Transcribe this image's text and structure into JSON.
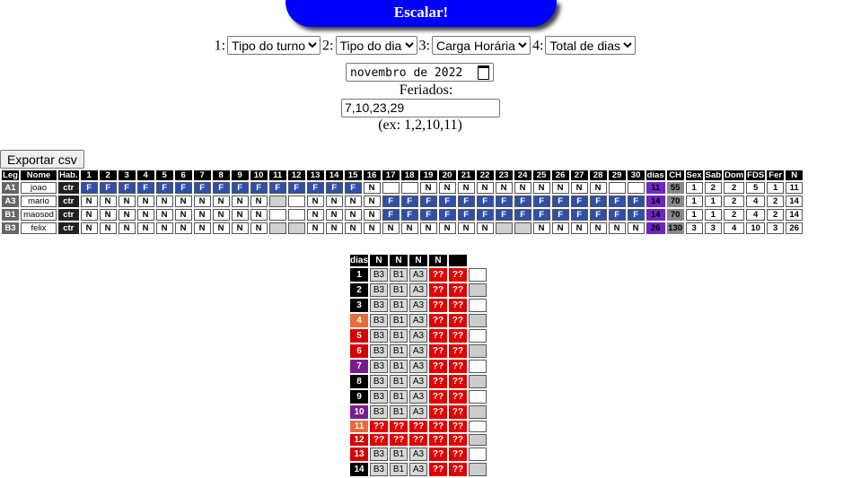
{
  "escalar_label": "Escalar!",
  "criteria": [
    {
      "num": "1:",
      "value": "Tipo do turno"
    },
    {
      "num": "2:",
      "value": "Tipo do dia"
    },
    {
      "num": "3:",
      "value": "Carga Horária"
    },
    {
      "num": "4:",
      "value": "Total de dias"
    }
  ],
  "month_value": "novembro de 2022",
  "feriados_label": "Feriados:",
  "feriados_value": "7,10,23,29",
  "feriados_hint": "(ex: 1,2,10,11)",
  "export_label": "Exportar csv",
  "schedule": {
    "headers": [
      "Leg",
      "Nome",
      "Hab."
    ],
    "day_colors": [
      "black",
      "black",
      "black",
      "orange",
      "red",
      "red",
      "purple",
      "black",
      "black",
      "purple",
      "orange",
      "red",
      "red",
      "black",
      "black",
      "black",
      "black",
      "orange",
      "red",
      "red",
      "black",
      "black",
      "purple",
      "black",
      "orange",
      "red",
      "red",
      "black",
      "purple",
      "black"
    ],
    "summary_headers": [
      {
        "label": "dias",
        "color": "violet"
      },
      {
        "label": "CH",
        "color": "gray"
      },
      {
        "label": "Sex",
        "color": "orange"
      },
      {
        "label": "Sab",
        "color": "red"
      },
      {
        "label": "Dom",
        "color": "red"
      },
      {
        "label": "FDS",
        "color": "violet"
      },
      {
        "label": "Fer",
        "color": "purple"
      },
      {
        "label": "N",
        "color": "black"
      }
    ],
    "rows": [
      {
        "leg": "A1",
        "nome": "joao",
        "hab": "ctr",
        "days": [
          "F",
          "F",
          "F",
          "F",
          "F",
          "F",
          "F",
          "F",
          "F",
          "F",
          "F",
          "F",
          "F",
          "F",
          "F",
          "N",
          "",
          "",
          "N",
          "N",
          "N",
          "N",
          "N",
          "N",
          "N",
          "N",
          "N",
          "N",
          "",
          ""
        ],
        "stats": [
          "11",
          "55",
          "1",
          "2",
          "2",
          "5",
          "1",
          "11"
        ]
      },
      {
        "leg": "A3",
        "nome": "mario",
        "hab": "ctr",
        "days": [
          "N",
          "N",
          "N",
          "N",
          "N",
          "N",
          "N",
          "N",
          "N",
          "N",
          "g",
          "",
          "N",
          "N",
          "N",
          "N",
          "F",
          "F",
          "F",
          "F",
          "F",
          "F",
          "F",
          "F",
          "F",
          "F",
          "F",
          "F",
          "F",
          "F"
        ],
        "stats": [
          "14",
          "70",
          "1",
          "1",
          "2",
          "4",
          "2",
          "14"
        ]
      },
      {
        "leg": "B1",
        "nome": "maosod",
        "hab": "ctr",
        "days": [
          "N",
          "N",
          "N",
          "N",
          "N",
          "N",
          "N",
          "N",
          "N",
          "N",
          "",
          "",
          "N",
          "N",
          "N",
          "N",
          "F",
          "F",
          "F",
          "F",
          "F",
          "F",
          "F",
          "F",
          "F",
          "F",
          "F",
          "F",
          "F",
          "F"
        ],
        "stats": [
          "14",
          "70",
          "1",
          "1",
          "2",
          "4",
          "2",
          "14"
        ]
      },
      {
        "leg": "B3",
        "nome": "felix",
        "hab": "ctr",
        "days": [
          "N",
          "N",
          "N",
          "N",
          "N",
          "N",
          "N",
          "N",
          "N",
          "N",
          "g",
          "g",
          "N",
          "N",
          "N",
          "N",
          "N",
          "N",
          "N",
          "N",
          "N",
          "N",
          "g",
          "g",
          "N",
          "N",
          "N",
          "N",
          "N",
          "N"
        ],
        "stats": [
          "26",
          "130",
          "3",
          "3",
          "4",
          "10",
          "3",
          "26"
        ]
      }
    ]
  },
  "coverage": {
    "headers": [
      "dias",
      "N",
      "N",
      "N",
      "N",
      ""
    ],
    "rows": [
      {
        "day": "1",
        "color": "black",
        "cells": [
          "B3",
          "B1",
          "A3",
          "??",
          "??"
        ],
        "last": "e"
      },
      {
        "day": "2",
        "color": "black",
        "cells": [
          "B3",
          "B1",
          "A3",
          "??",
          "??"
        ],
        "last": "g"
      },
      {
        "day": "3",
        "color": "black",
        "cells": [
          "B3",
          "B1",
          "A3",
          "??",
          "??"
        ],
        "last": "e"
      },
      {
        "day": "4",
        "color": "orange",
        "cells": [
          "B3",
          "B1",
          "A3",
          "??",
          "??"
        ],
        "last": "g"
      },
      {
        "day": "5",
        "color": "red",
        "cells": [
          "B3",
          "B1",
          "A3",
          "??",
          "??"
        ],
        "last": "e"
      },
      {
        "day": "6",
        "color": "red",
        "cells": [
          "B3",
          "B1",
          "A3",
          "??",
          "??"
        ],
        "last": "g"
      },
      {
        "day": "7",
        "color": "purple",
        "cells": [
          "B3",
          "B1",
          "A3",
          "??",
          "??"
        ],
        "last": "e"
      },
      {
        "day": "8",
        "color": "black",
        "cells": [
          "B3",
          "B1",
          "A3",
          "??",
          "??"
        ],
        "last": "g"
      },
      {
        "day": "9",
        "color": "black",
        "cells": [
          "B3",
          "B1",
          "A3",
          "??",
          "??"
        ],
        "last": "e"
      },
      {
        "day": "10",
        "color": "purple",
        "cells": [
          "B3",
          "B1",
          "A3",
          "??",
          "??"
        ],
        "last": "g"
      },
      {
        "day": "11",
        "color": "orange",
        "cells": [
          "??",
          "??",
          "??",
          "??",
          "??"
        ],
        "last": "e"
      },
      {
        "day": "12",
        "color": "red",
        "cells": [
          "??",
          "??",
          "??",
          "??",
          "??"
        ],
        "last": "g"
      },
      {
        "day": "13",
        "color": "red",
        "cells": [
          "B3",
          "B1",
          "A3",
          "??",
          "??"
        ],
        "last": "e"
      },
      {
        "day": "14",
        "color": "black",
        "cells": [
          "B3",
          "B1",
          "A3",
          "??",
          "??"
        ],
        "last": "g"
      }
    ]
  }
}
